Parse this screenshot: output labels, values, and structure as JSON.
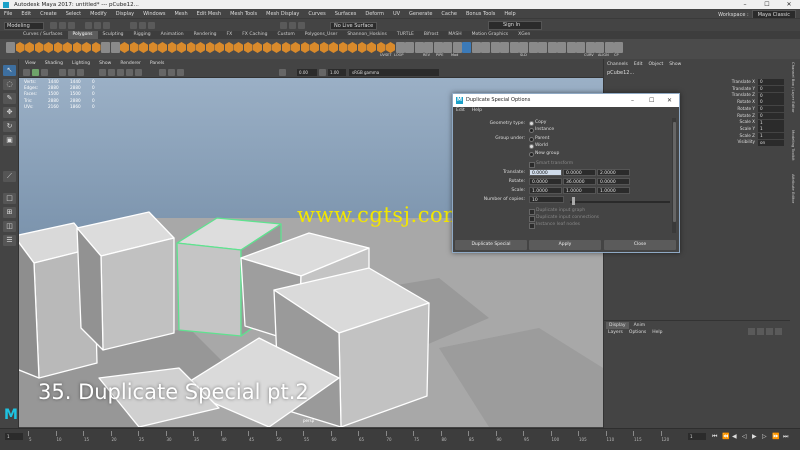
{
  "window": {
    "title": "Autodesk Maya 2017: untitled*   ---   pCube12...",
    "controls": [
      "–",
      "☐",
      "✕"
    ]
  },
  "menubar": {
    "items": [
      "File",
      "Edit",
      "Create",
      "Select",
      "Modify",
      "Display",
      "Windows",
      "Mesh",
      "Edit Mesh",
      "Mesh Tools",
      "Mesh Display",
      "Curves",
      "Surfaces",
      "Deform",
      "UV",
      "Generate",
      "Cache",
      "Bonus Tools",
      "Help"
    ],
    "workspace_label": "Workspace :",
    "workspace_value": "Maya Classic"
  },
  "statusline": {
    "mode": "Modeling",
    "no_live_surface": "No Live Surface",
    "sign_in": "Sign In"
  },
  "shelf": {
    "tabs": [
      "Curves / Surfaces",
      "Polygons",
      "Sculpting",
      "Rigging",
      "Animation",
      "Rendering",
      "FX",
      "FX Caching",
      "Custom",
      "Polygons_User",
      "Shannon_Hoskins",
      "TURTLE",
      "Bifrost",
      "MASH",
      "Motion Graphics",
      "XGen"
    ],
    "active_tab": "Polygons",
    "labels": [
      "UVSET",
      "LOOP",
      "REV",
      "PIPE",
      "Mod",
      "SLD",
      "CURV",
      "ALIGN",
      "CP"
    ]
  },
  "viewport": {
    "menu": [
      "View",
      "Shading",
      "Lighting",
      "Show",
      "Renderer",
      "Panels"
    ],
    "field_a": "0.00",
    "field_b": "1.00",
    "color_space": "sRGB gamma",
    "camera": "persp",
    "hud": [
      {
        "k": "Verts:",
        "a": "1440",
        "b": "1440",
        "c": "0"
      },
      {
        "k": "Edges:",
        "a": "2880",
        "b": "2880",
        "c": "0"
      },
      {
        "k": "Faces:",
        "a": "1500",
        "b": "1500",
        "c": "0"
      },
      {
        "k": "Tris:",
        "a": "2880",
        "b": "2880",
        "c": "0"
      },
      {
        "k": "UVs:",
        "a": "2160",
        "b": "1860",
        "c": "0"
      }
    ]
  },
  "overlay": {
    "watermark": "www.cgtsj.com",
    "caption": "35. Duplicate Special pt.2",
    "logo": "M"
  },
  "channel_box": {
    "menu": [
      "Channels",
      "Edit",
      "Object",
      "Show"
    ],
    "object": "pCube12...",
    "attrs": [
      {
        "name": "Translate X",
        "value": "0"
      },
      {
        "name": "Translate Y",
        "value": "0"
      },
      {
        "name": "Translate Z",
        "value": "0"
      },
      {
        "name": "Rotate X",
        "value": "0"
      },
      {
        "name": "Rotate Y",
        "value": "0"
      },
      {
        "name": "Rotate Z",
        "value": "0"
      },
      {
        "name": "Scale X",
        "value": "1"
      },
      {
        "name": "Scale Y",
        "value": "1"
      },
      {
        "name": "Scale Z",
        "value": "1"
      },
      {
        "name": "Visibility",
        "value": "on"
      }
    ],
    "side_tabs": [
      "Channel Box / Layer Editor",
      "Modeling Toolkit",
      "Attribute Editor"
    ]
  },
  "layer_editor": {
    "tabs": [
      "Display",
      "Anim"
    ],
    "active_tab": "Display",
    "menu": [
      "Layers",
      "Options",
      "Help"
    ]
  },
  "timeline": {
    "start": "1",
    "end": "1",
    "ticks": [
      "5",
      "10",
      "15",
      "20",
      "25",
      "30",
      "35",
      "40",
      "45",
      "50",
      "55",
      "60",
      "65",
      "70",
      "75",
      "80",
      "85",
      "90",
      "95",
      "100",
      "105",
      "110",
      "115",
      "120"
    ]
  },
  "dialog": {
    "title": "Duplicate Special Options",
    "menu": [
      "Edit",
      "Help"
    ],
    "geometry_type_label": "Geometry type:",
    "geometry_options": [
      "Copy",
      "Instance"
    ],
    "geometry_selected": "Copy",
    "group_under_label": "Group under:",
    "group_options": [
      "Parent",
      "World",
      "New group"
    ],
    "group_selected": "World",
    "smart_transform": "Smart transform",
    "translate_label": "Translate:",
    "translate": [
      "0.0000",
      "0.0000",
      "2.0000"
    ],
    "rotate_label": "Rotate:",
    "rotate": [
      "0.0000",
      "36.0000",
      "0.0000"
    ],
    "scale_label": "Scale:",
    "scale": [
      "1.0000",
      "1.0000",
      "1.0000"
    ],
    "copies_label": "Number of copies:",
    "copies": "10",
    "dup_graph": "Duplicate input graph",
    "dup_connections": "Duplicate input connections",
    "instance_leaf": "Instance leaf nodes",
    "buttons": {
      "duplicate": "Duplicate Special",
      "apply": "Apply",
      "close": "Close"
    }
  },
  "colors": {
    "accent": "#1aa0c8",
    "shelf_orange": "#d98a2b",
    "selected_outline": "#5fe28f",
    "watermark": "#f2e600"
  }
}
